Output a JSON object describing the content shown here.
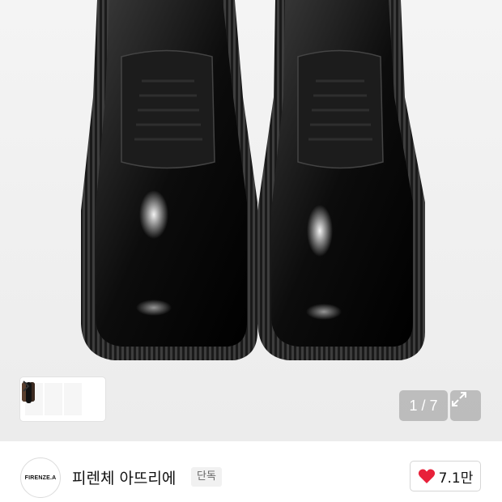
{
  "gallery": {
    "counter": "1 / 7",
    "thumbnails": [
      "shoes-black-pair",
      "shoes-brown-pair",
      "shoe-black-single"
    ]
  },
  "brand": {
    "logo_text": "FIRENZE.A",
    "name": "피렌체 아뜨리에",
    "badge": "단독"
  },
  "like": {
    "count": "7.1만",
    "color": "#e8213a"
  }
}
